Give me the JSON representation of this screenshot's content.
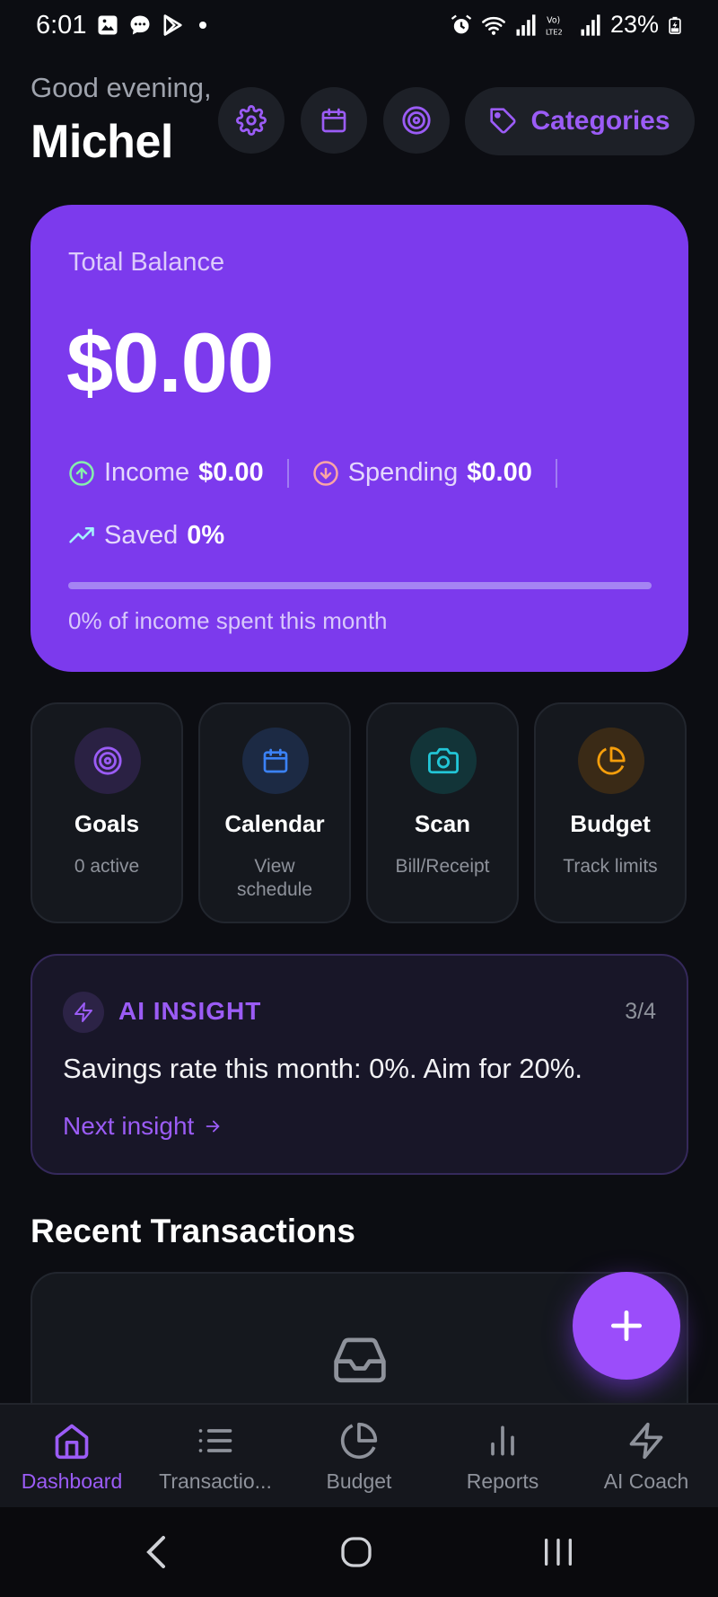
{
  "status_bar": {
    "time": "6:01",
    "battery": "23%",
    "left_icons": [
      "image-icon",
      "chat-bubble-icon",
      "play-store-icon",
      "dot-icon"
    ],
    "right_icons": [
      "alarm-icon",
      "wifi-icon",
      "signal-icon",
      "volte-icon",
      "signal-icon",
      "battery-charging-icon"
    ]
  },
  "header": {
    "greeting": "Good evening,",
    "user_name": "Michel",
    "buttons": [
      "gear-icon",
      "calendar-icon",
      "target-icon"
    ],
    "categories_label": "Categories"
  },
  "balance_card": {
    "label": "Total Balance",
    "amount": "$0.00",
    "income_label": "Income",
    "income_value": "$0.00",
    "spending_label": "Spending",
    "spending_value": "$0.00",
    "saved_label": "Saved",
    "saved_value": "0%",
    "progress_percent": 0,
    "caption": "0% of income spent this month"
  },
  "tiles": [
    {
      "title": "Goals",
      "subtitle": "0 active",
      "icon": "target-icon"
    },
    {
      "title": "Calendar",
      "subtitle": "View schedule",
      "icon": "calendar-icon"
    },
    {
      "title": "Scan",
      "subtitle": "Bill/Receipt",
      "icon": "camera-icon"
    },
    {
      "title": "Budget",
      "subtitle": "Track limits",
      "icon": "pie-chart-icon"
    }
  ],
  "insight": {
    "title": "AI INSIGHT",
    "count": "3/4",
    "text": "Savings rate this month: 0%. Aim for 20%.",
    "next_label": "Next insight"
  },
  "recent": {
    "title": "Recent Transactions",
    "empty_icon": "inbox-icon"
  },
  "fab": {
    "icon": "plus-icon"
  },
  "bottom_nav": [
    {
      "label": "Dashboard",
      "icon": "home-icon",
      "active": true
    },
    {
      "label": "Transactio...",
      "icon": "list-icon",
      "active": false
    },
    {
      "label": "Budget",
      "icon": "pie-chart-icon",
      "active": false
    },
    {
      "label": "Reports",
      "icon": "bar-chart-icon",
      "active": false
    },
    {
      "label": "AI Coach",
      "icon": "lightning-icon",
      "active": false
    }
  ],
  "system_nav": [
    "back-icon",
    "home-circle-icon",
    "recents-icon"
  ],
  "colors": {
    "background": "#0c0d12",
    "accent": "#9b5cf6",
    "card_purple": "#7c3aed",
    "tile_bg": "#15181e"
  }
}
